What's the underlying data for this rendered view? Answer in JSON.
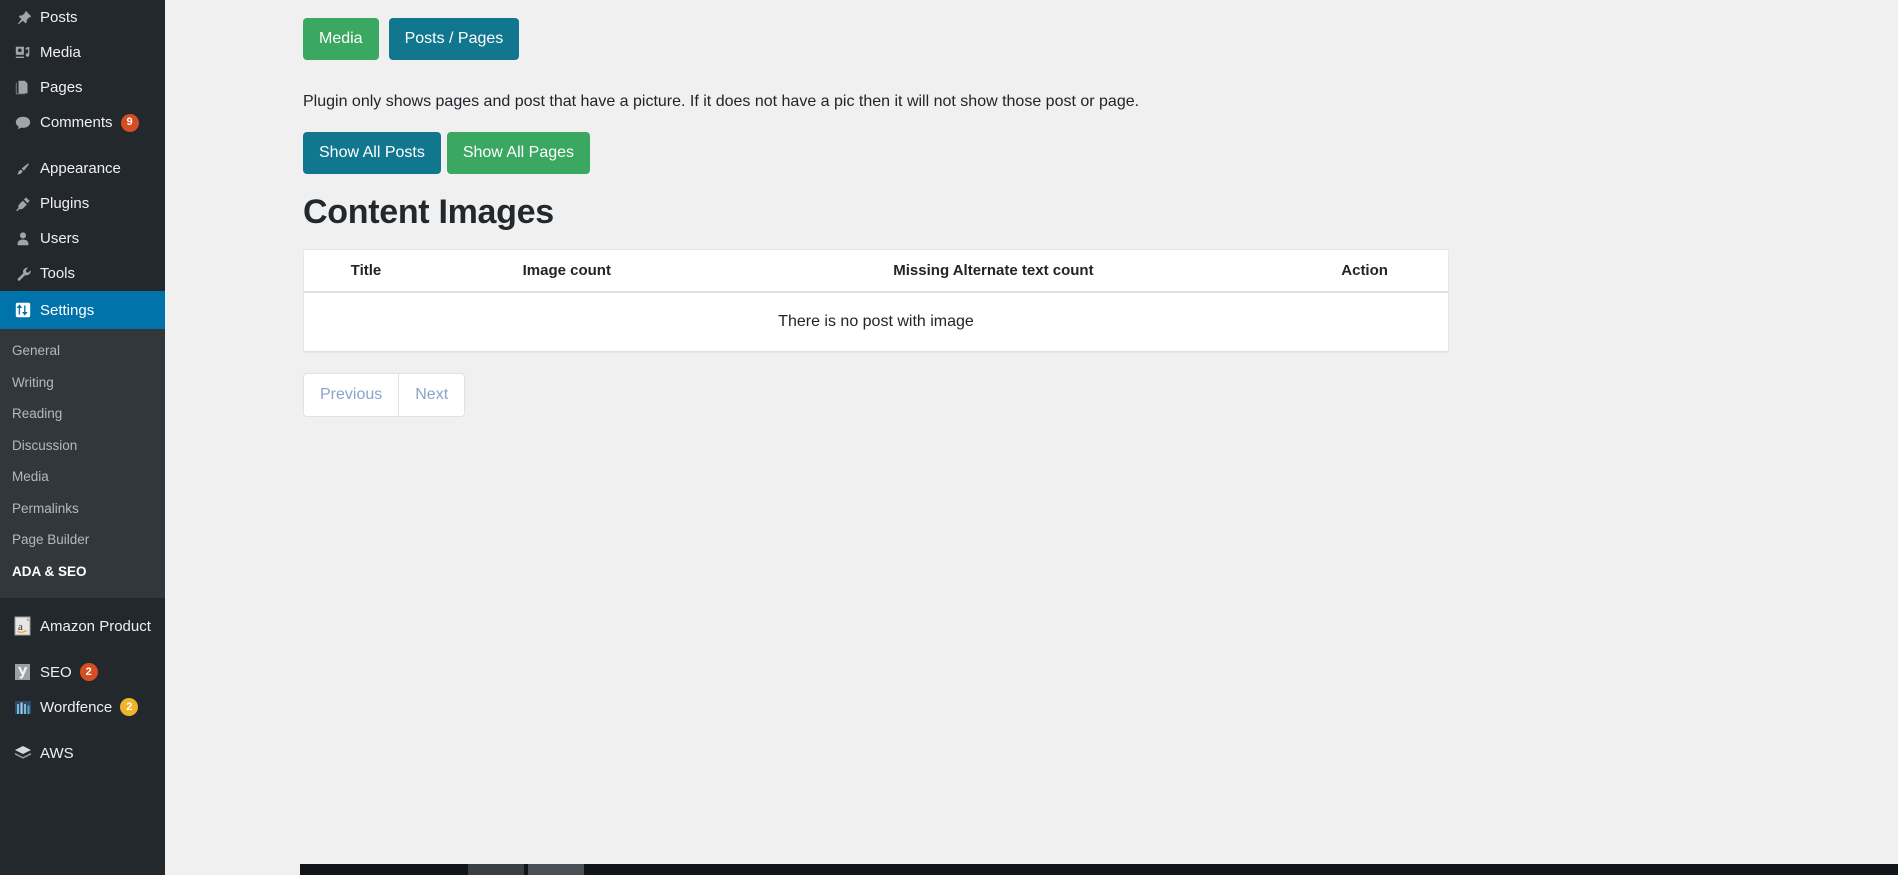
{
  "sidebar": {
    "top_items": [
      {
        "label": "Posts",
        "icon": "pin-icon",
        "badge": null,
        "current": false,
        "gap": false
      },
      {
        "label": "Media",
        "icon": "media-icon",
        "badge": null,
        "current": false,
        "gap": false
      },
      {
        "label": "Pages",
        "icon": "pages-icon",
        "badge": null,
        "current": false,
        "gap": false
      },
      {
        "label": "Comments",
        "icon": "comment-icon",
        "badge": "9",
        "current": false,
        "gap": false
      },
      {
        "label": "Appearance",
        "icon": "brush-icon",
        "badge": null,
        "current": false,
        "gap": true
      },
      {
        "label": "Plugins",
        "icon": "plug-icon",
        "badge": null,
        "current": false,
        "gap": false
      },
      {
        "label": "Users",
        "icon": "user-icon",
        "badge": null,
        "current": false,
        "gap": false
      },
      {
        "label": "Tools",
        "icon": "wrench-icon",
        "badge": null,
        "current": false,
        "gap": false
      },
      {
        "label": "Settings",
        "icon": "settings-icon",
        "badge": null,
        "current": true,
        "gap": false
      }
    ],
    "submenu": [
      {
        "label": "General",
        "current": false
      },
      {
        "label": "Writing",
        "current": false
      },
      {
        "label": "Reading",
        "current": false
      },
      {
        "label": "Discussion",
        "current": false
      },
      {
        "label": "Media",
        "current": false
      },
      {
        "label": "Permalinks",
        "current": false
      },
      {
        "label": "Page Builder",
        "current": false
      },
      {
        "label": "ADA & SEO",
        "current": true
      }
    ],
    "plugin_items": [
      {
        "label": "Amazon Product",
        "icon": "amazon-icon",
        "badge": null,
        "badge_color": null,
        "gap": true
      },
      {
        "label": "SEO",
        "icon": "yoast-icon",
        "badge": "2",
        "badge_color": "#d54e21",
        "gap": true
      },
      {
        "label": "Wordfence",
        "icon": "wordfence-icon",
        "badge": "2",
        "badge_color": "#f0b429",
        "gap": false
      },
      {
        "label": "AWS",
        "icon": "aws-icon",
        "badge": null,
        "badge_color": null,
        "gap": true
      }
    ]
  },
  "main": {
    "tabs": [
      {
        "label": "Media",
        "color": "#3aa860"
      },
      {
        "label": "Posts / Pages",
        "color": "#10778f"
      }
    ],
    "notice": "Plugin only shows pages and post that have a picture. If it does not have a pic then it will not show those post or page.",
    "actions": [
      {
        "label": "Show All Posts",
        "color": "#10778f"
      },
      {
        "label": "Show All Pages",
        "color": "#3aa860"
      }
    ],
    "page_title": "Content Images",
    "table": {
      "headers": [
        "Title",
        "Image count",
        "Missing Alternate text count",
        "Action"
      ],
      "empty_message": "There is no post with image",
      "rows": []
    },
    "pagination": {
      "previous_label": "Previous",
      "next_label": "Next"
    }
  },
  "colors": {
    "admin_bg": "#23282d",
    "submenu_bg": "#32373c",
    "current_blue": "#0073aa",
    "green": "#3aa860",
    "teal": "#10778f",
    "content_bg": "#f0f0f1"
  }
}
